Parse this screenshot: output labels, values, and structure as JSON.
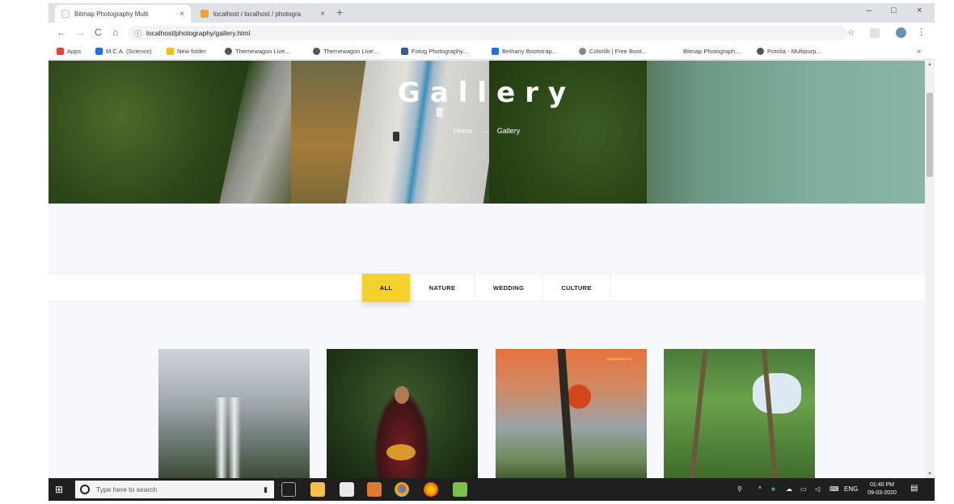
{
  "browser": {
    "tabs": [
      {
        "title": "Bitmap Photography Multi",
        "close": "×",
        "favicon_color": "#f1f3f4"
      },
      {
        "title": "localhost / localhost / photogra",
        "close": "×",
        "favicon_color": "#e8a33a"
      }
    ],
    "new_tab": "+",
    "window_controls": {
      "minimize": "–",
      "maximize": "□",
      "close": "×"
    },
    "nav": {
      "back": "←",
      "forward": "→",
      "reload": "C",
      "home": "⌂"
    },
    "url": "localhost/photography/gallery.html",
    "info_icon": "ⓘ",
    "star": "☆",
    "menu": "⋮",
    "bookmarks": [
      {
        "label": "Apps",
        "color": "#e94235"
      },
      {
        "label": "M.C.A. (Science)",
        "color": "#1a73e8"
      },
      {
        "label": "New folder",
        "color": "#f4c20d"
      },
      {
        "label": "Themewagon Live...",
        "color": "#555555"
      },
      {
        "label": "Themewagon Live...",
        "color": "#555555"
      },
      {
        "label": "Fotog Photography...",
        "color": "#3b5998"
      },
      {
        "label": "Bethany Bootstrap...",
        "color": "#1a73e8"
      },
      {
        "label": "Colorlib | Free Boot...",
        "color": "#888888"
      },
      {
        "label": "Bitmap Photograph...",
        "color": "#ffffff"
      },
      {
        "label": "Potolia - Multipurp...",
        "color": "#555555"
      }
    ],
    "bookmarks_more": "»"
  },
  "hero": {
    "title": "Gallery",
    "breadcrumb_home": "Home",
    "breadcrumb_sep": "→",
    "breadcrumb_current": "Gallery"
  },
  "filters": [
    {
      "label": "ALL",
      "active": true
    },
    {
      "label": "NATURE",
      "active": false
    },
    {
      "label": "WEDDING",
      "active": false
    },
    {
      "label": "CULTURE",
      "active": false
    }
  ],
  "gallery": {
    "thumbs": [
      "waterfall",
      "woman-with-basket",
      "sunset-tree",
      "palm-trees"
    ],
    "watermark": "Independence"
  },
  "taskbar": {
    "start_icon": "⊞",
    "search_placeholder": "Type here to search",
    "mic": "🎤",
    "tray_lang": "ENG",
    "time": "01:40 PM",
    "date": "09-03-2020",
    "notification_icon": "🗨"
  }
}
